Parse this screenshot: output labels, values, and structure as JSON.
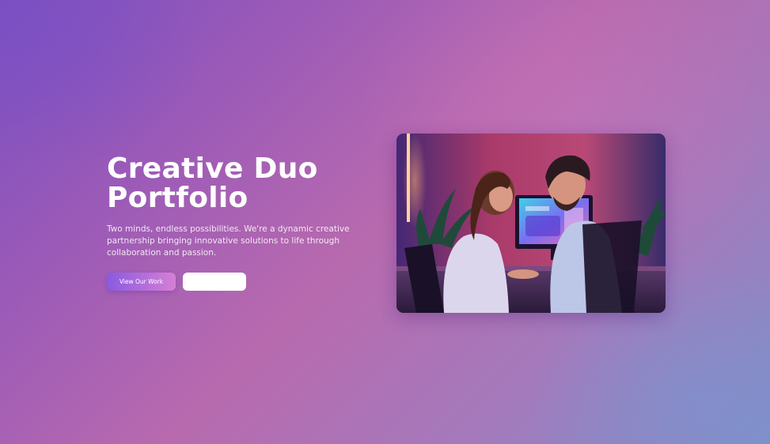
{
  "hero": {
    "title_line1": "Creative Duo",
    "title_line2": "Portfolio",
    "description": "Two minds, endless possibilities. We're a dynamic creative partnership bringing innovative solutions to life through collaboration and passion.",
    "primary_button_label": "View Our Work",
    "secondary_button_label": ""
  },
  "image": {
    "subject": "two people working together at a computer in a neon-lit studio"
  },
  "colors": {
    "background_start": "#7b4fc0",
    "background_mid": "#b86aae",
    "background_end": "#7f8fc8",
    "primary_button_start": "#8a5ae0",
    "primary_button_end": "#d67fd6",
    "text": "#ffffff"
  }
}
